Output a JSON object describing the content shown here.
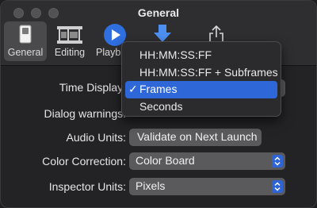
{
  "window": {
    "title": "General"
  },
  "toolbar": {
    "items": [
      {
        "label": "General",
        "icon": "toggle-switch-icon",
        "selected": true
      },
      {
        "label": "Editing",
        "icon": "film-strip-icon"
      },
      {
        "label": "Playb",
        "icon": "play-icon"
      },
      {
        "label": "",
        "icon": "download-arrow-icon"
      },
      {
        "label": "",
        "icon": "share-icon"
      }
    ]
  },
  "settings": {
    "time_display_label": "Time Display:",
    "dialog_warnings_label": "Dialog warnings:",
    "audio_units_label": "Audio Units:",
    "audio_units_button": "Validate on Next Launch",
    "color_correction_label": "Color Correction:",
    "color_correction_value": "Color Board",
    "inspector_units_label": "Inspector Units:",
    "inspector_units_value": "Pixels"
  },
  "dropdown_menu": {
    "options": [
      {
        "label": "HH:MM:SS:FF",
        "checked": false
      },
      {
        "label": "HH:MM:SS:FF + Subframes",
        "checked": false
      },
      {
        "label": "Frames",
        "checked": true
      },
      {
        "label": "Seconds",
        "checked": false
      }
    ],
    "check_mark": "✓"
  },
  "colors": {
    "accent": "#2d67d8",
    "window_bg": "#232325",
    "control_bg": "#5a5a5c"
  }
}
